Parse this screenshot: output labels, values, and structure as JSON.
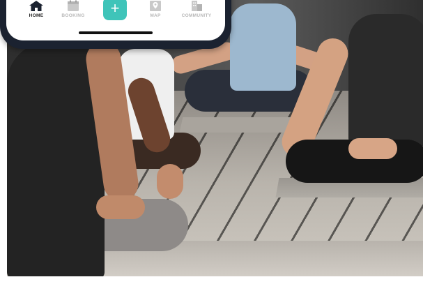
{
  "nav": {
    "tabs": [
      {
        "label": "HOME",
        "icon": "house-icon",
        "active": true
      },
      {
        "label": "BOOKING",
        "icon": "calendar-icon",
        "active": false
      },
      {
        "label": "MAP",
        "icon": "map-icon",
        "active": false
      },
      {
        "label": "COMMUNITY",
        "icon": "buildings-icon",
        "active": false
      }
    ],
    "add_button": {
      "label": "+",
      "icon": "plus-icon"
    }
  },
  "colors": {
    "accent": "#3fc4b9",
    "active_text": "#1d1d1d",
    "inactive_text": "#b7b7b7",
    "phone_frame": "#1b2230"
  },
  "background_image": {
    "subject": "people-meditating-in-yoga-class"
  }
}
